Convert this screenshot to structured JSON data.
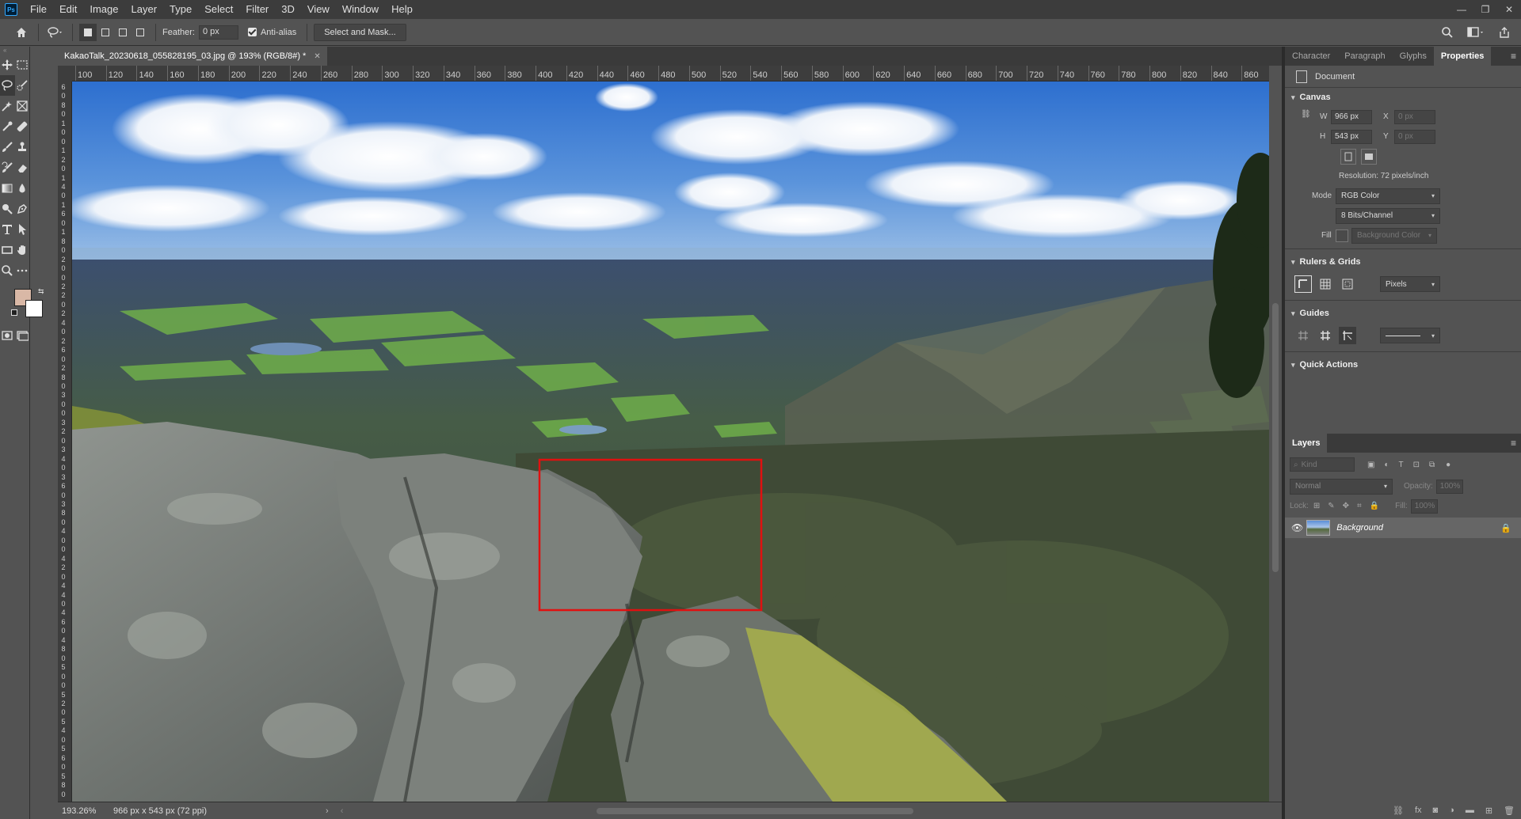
{
  "menu": {
    "logo": "Ps",
    "items": [
      "File",
      "Edit",
      "Image",
      "Layer",
      "Type",
      "Select",
      "Filter",
      "3D",
      "View",
      "Window",
      "Help"
    ]
  },
  "options": {
    "feather_label": "Feather:",
    "feather_value": "0 px",
    "antialias_label": "Anti-alias",
    "select_mask_label": "Select and Mask..."
  },
  "document": {
    "tab_title": "KakaoTalk_20230618_055828195_03.jpg @ 193% (RGB/8#) *",
    "ruler_h": [
      "100",
      "120",
      "140",
      "160",
      "180",
      "200",
      "220",
      "240",
      "260",
      "280",
      "300",
      "320",
      "340",
      "360",
      "380",
      "400",
      "420",
      "440",
      "460",
      "480",
      "500",
      "520",
      "540",
      "560",
      "580",
      "600",
      "620",
      "640",
      "660",
      "680",
      "700",
      "720",
      "740",
      "760",
      "780",
      "800",
      "820",
      "840",
      "860"
    ],
    "ruler_v": [
      "6",
      "0",
      "8",
      "0",
      "1",
      "0",
      "0",
      "1",
      "2",
      "0",
      "1",
      "4",
      "0",
      "1",
      "6",
      "0",
      "1",
      "8",
      "0",
      "2",
      "0",
      "0",
      "2",
      "2",
      "0",
      "2",
      "4",
      "0",
      "2",
      "6",
      "0",
      "2",
      "8",
      "0",
      "3",
      "0",
      "0",
      "3",
      "2",
      "0",
      "3",
      "4",
      "0",
      "3",
      "6",
      "0",
      "3",
      "8",
      "0",
      "4",
      "0",
      "0",
      "4",
      "2",
      "0",
      "4",
      "4",
      "0",
      "4",
      "6",
      "0",
      "4",
      "8",
      "0",
      "5",
      "0",
      "0",
      "5",
      "2",
      "0",
      "5",
      "4",
      "0",
      "5",
      "6",
      "0",
      "5",
      "8",
      "0"
    ]
  },
  "status": {
    "zoom": "193.26%",
    "info": "966 px x 543 px (72 ppi)"
  },
  "properties": {
    "tabs": [
      "Character",
      "Paragraph",
      "Glyphs",
      "Properties"
    ],
    "doc_label": "Document",
    "canvas_title": "Canvas",
    "w_label": "W",
    "w_value": "966 px",
    "h_label": "H",
    "h_value": "543 px",
    "x_label": "X",
    "x_value": "0 px",
    "y_label": "Y",
    "y_value": "0 px",
    "resolution": "Resolution: 72 pixels/inch",
    "mode_label": "Mode",
    "mode_value": "RGB Color",
    "bits_value": "8 Bits/Channel",
    "fill_label": "Fill",
    "fill_value": "Background Color",
    "rulers_title": "Rulers & Grids",
    "units_value": "Pixels",
    "guides_title": "Guides",
    "quick_title": "Quick Actions"
  },
  "layers": {
    "tab": "Layers",
    "kind_placeholder": "Kind",
    "blend": "Normal",
    "opacity_label": "Opacity:",
    "opacity_value": "100%",
    "lock_label": "Lock:",
    "fill_label": "Fill:",
    "fill_value": "100%",
    "layer_name": "Background"
  },
  "colors": {
    "foreground": "#d9b8a6",
    "background": "#ffffff",
    "selection": "#e01010"
  }
}
